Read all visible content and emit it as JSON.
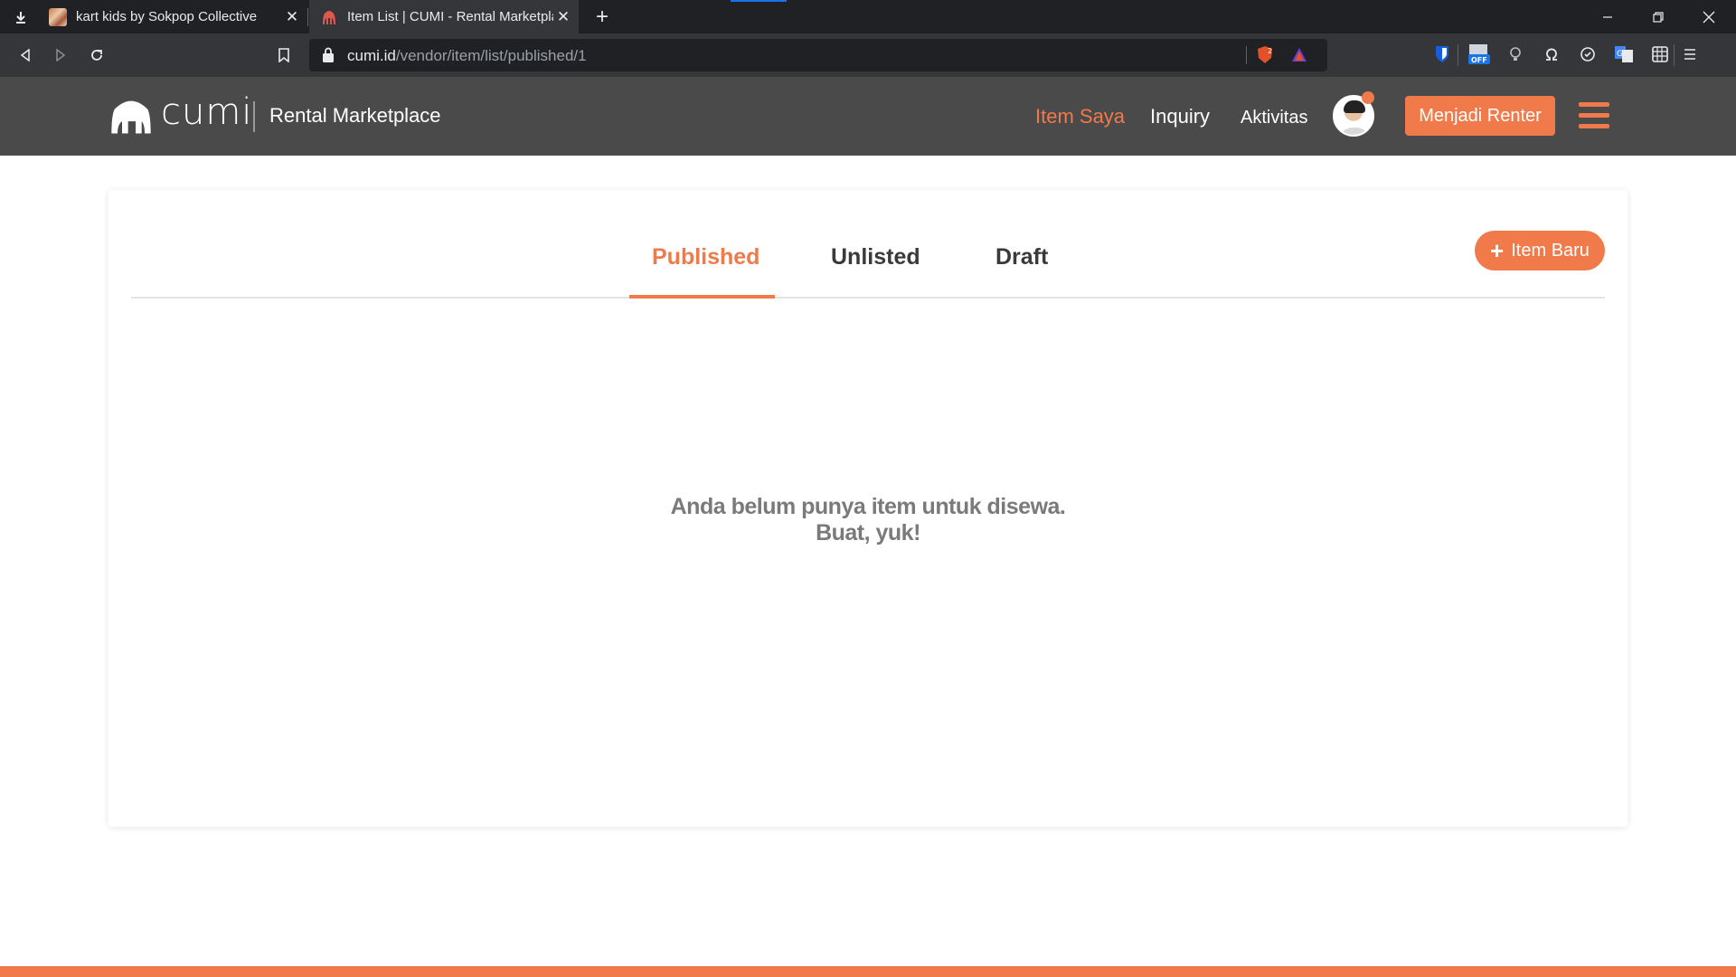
{
  "browser": {
    "tabs": [
      {
        "title": "kart kids by Sokpop Collective",
        "active": false
      },
      {
        "title": "Item List | CUMI - Rental Marketplace",
        "active": true
      }
    ],
    "url_host": "cumi.id",
    "url_path": "/vendor/item/list/published/1",
    "shield_count": "2",
    "ext_off_badge": "OFF"
  },
  "site": {
    "logo_text": "cumi",
    "brand_tagline": "Rental Marketplace",
    "nav": {
      "item_saya": "Item Saya",
      "inquiry": "Inquiry",
      "aktivitas": "Aktivitas"
    },
    "cta_label": "Menjadi Renter"
  },
  "main": {
    "tabs": [
      {
        "label": "Published",
        "active": true
      },
      {
        "label": "Unlisted",
        "active": false
      },
      {
        "label": "Draft",
        "active": false
      }
    ],
    "new_item_label": "Item Baru",
    "empty_line1": "Anda belum punya item untuk disewa.",
    "empty_line2": "Buat, yuk!"
  },
  "colors": {
    "accent": "#f07a4a",
    "header_bg": "#4a4a4a",
    "tab_text": "#3a3a3a",
    "empty_text": "#7a7a7a"
  }
}
